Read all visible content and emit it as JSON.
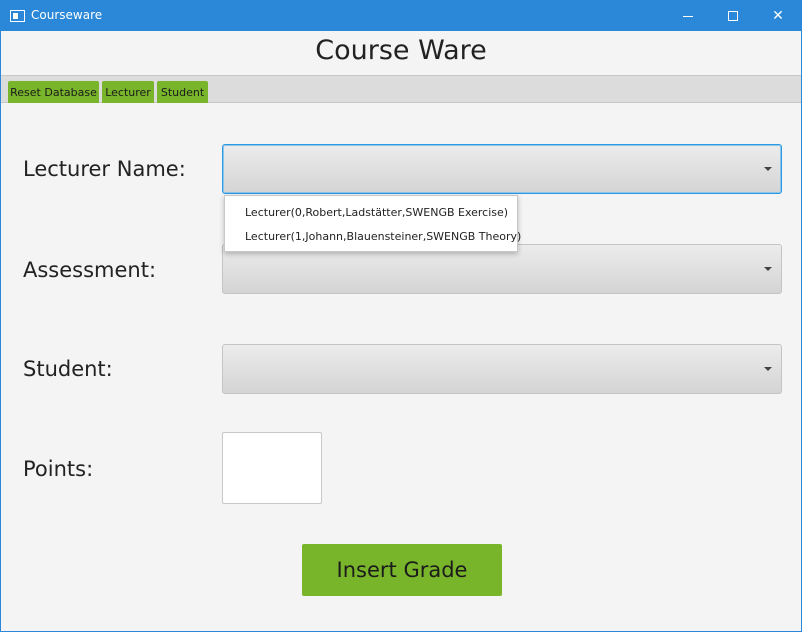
{
  "window": {
    "title": "Courseware",
    "accent_color": "#2b88d8",
    "controls": {
      "minimize_icon": "minimize-icon",
      "maximize_icon": "maximize-icon",
      "close_label": "✕"
    }
  },
  "header": {
    "title": "Course Ware"
  },
  "tabs": [
    {
      "label": "Reset Database",
      "color": "#79b52a"
    },
    {
      "label": "Lecturer",
      "color": "#79b52a"
    },
    {
      "label": "Student",
      "color": "#79b52a"
    }
  ],
  "form": {
    "lecturer_label": "Lecturer Name:",
    "lecturer_value": "",
    "lecturer_options": [
      "Lecturer(0,Robert,Ladstätter,SWENGB Exercise)",
      "Lecturer(1,Johann,Blauensteiner,SWENGB Theory)"
    ],
    "assessment_label": "Assessment:",
    "assessment_value": "",
    "student_label": "Student:",
    "student_value": "",
    "points_label": "Points:",
    "points_value": "",
    "submit_label": "Insert Grade",
    "submit_color": "#79b52a"
  }
}
